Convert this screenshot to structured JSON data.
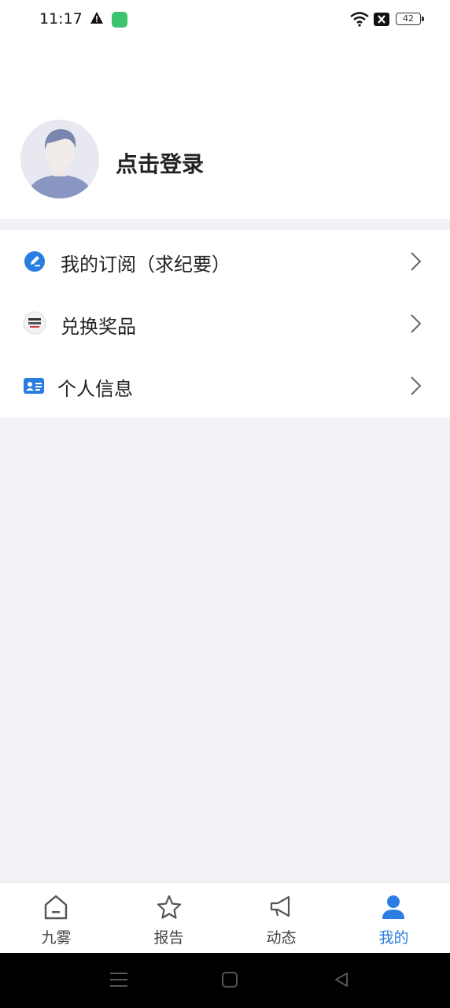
{
  "status": {
    "time": "11:17",
    "battery": "42",
    "icons": [
      "warning-icon",
      "app-notification-icon",
      "wifi-icon",
      "no-signal-icon",
      "battery-icon"
    ]
  },
  "profile": {
    "login_text": "点击登录",
    "avatar_icon": "default-avatar"
  },
  "menu": {
    "items": [
      {
        "label": "我的订阅（求纪要）",
        "icon": "edit-circle-icon"
      },
      {
        "label": "兑换奖品",
        "icon": "gift-logo-icon"
      },
      {
        "label": "个人信息",
        "icon": "id-card-icon"
      }
    ]
  },
  "tabbar": {
    "tabs": [
      {
        "label": "九雾",
        "icon": "home-icon",
        "active": false
      },
      {
        "label": "报告",
        "icon": "star-icon",
        "active": false
      },
      {
        "label": "动态",
        "icon": "megaphone-icon",
        "active": false
      },
      {
        "label": "我的",
        "icon": "user-icon",
        "active": true
      }
    ]
  },
  "colors": {
    "accent": "#2a7de1",
    "background": "#f1f2f6",
    "card": "#ffffff"
  }
}
